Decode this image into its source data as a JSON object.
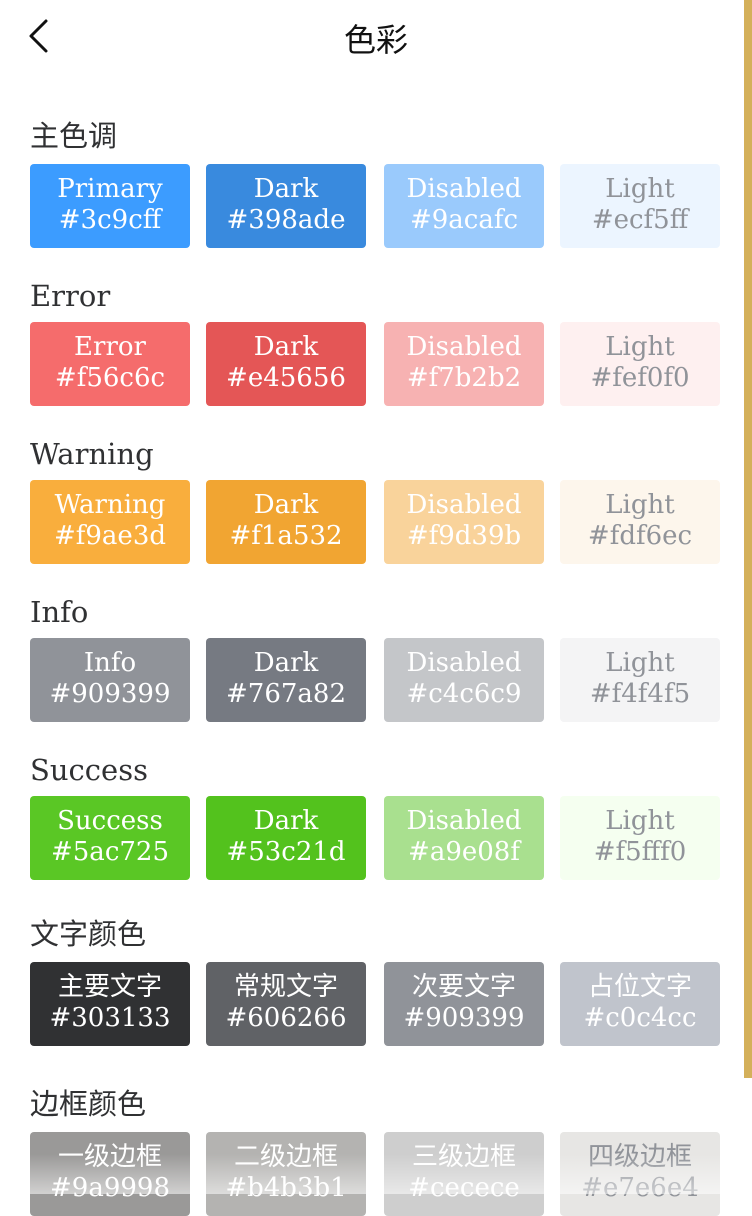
{
  "header": {
    "title": "色彩",
    "back_icon": "chevron-left-icon"
  },
  "accent_edge_color": "#d4b05a",
  "sections": [
    {
      "title": "主色调",
      "swatches": [
        {
          "label": "Primary",
          "value": "#3c9cff",
          "bg": "#3c9cff",
          "fg": "#ffffff"
        },
        {
          "label": "Dark",
          "value": "#398ade",
          "bg": "#398ade",
          "fg": "#ffffff"
        },
        {
          "label": "Disabled",
          "value": "#9acafc",
          "bg": "#9acafc",
          "fg": "#ffffff"
        },
        {
          "label": "Light",
          "value": "#ecf5ff",
          "bg": "#ecf5ff",
          "fg": "#909399"
        }
      ]
    },
    {
      "title": "Error",
      "swatches": [
        {
          "label": "Error",
          "value": "#f56c6c",
          "bg": "#f56c6c",
          "fg": "#ffffff"
        },
        {
          "label": "Dark",
          "value": "#e45656",
          "bg": "#e45656",
          "fg": "#ffffff"
        },
        {
          "label": "Disabled",
          "value": "#f7b2b2",
          "bg": "#f7b2b2",
          "fg": "#ffffff"
        },
        {
          "label": "Light",
          "value": "#fef0f0",
          "bg": "#fef0f0",
          "fg": "#909399"
        }
      ]
    },
    {
      "title": "Warning",
      "swatches": [
        {
          "label": "Warning",
          "value": "#f9ae3d",
          "bg": "#f9ae3d",
          "fg": "#ffffff"
        },
        {
          "label": "Dark",
          "value": "#f1a532",
          "bg": "#f1a532",
          "fg": "#ffffff"
        },
        {
          "label": "Disabled",
          "value": "#f9d39b",
          "bg": "#f9d39b",
          "fg": "#ffffff"
        },
        {
          "label": "Light",
          "value": "#fdf6ec",
          "bg": "#fdf6ec",
          "fg": "#909399"
        }
      ]
    },
    {
      "title": "Info",
      "swatches": [
        {
          "label": "Info",
          "value": "#909399",
          "bg": "#909399",
          "fg": "#ffffff"
        },
        {
          "label": "Dark",
          "value": "#767a82",
          "bg": "#767a82",
          "fg": "#ffffff"
        },
        {
          "label": "Disabled",
          "value": "#c4c6c9",
          "bg": "#c4c6c9",
          "fg": "#ffffff"
        },
        {
          "label": "Light",
          "value": "#f4f4f5",
          "bg": "#f4f4f5",
          "fg": "#909399"
        }
      ]
    },
    {
      "title": "Success",
      "swatches": [
        {
          "label": "Success",
          "value": "#5ac725",
          "bg": "#5ac725",
          "fg": "#ffffff"
        },
        {
          "label": "Dark",
          "value": "#53c21d",
          "bg": "#53c21d",
          "fg": "#ffffff"
        },
        {
          "label": "Disabled",
          "value": "#a9e08f",
          "bg": "#a9e08f",
          "fg": "#ffffff"
        },
        {
          "label": "Light",
          "value": "#f5fff0",
          "bg": "#f5fff0",
          "fg": "#909399"
        }
      ]
    },
    {
      "title": "文字颜色",
      "swatches": [
        {
          "label": "主要文字",
          "value": "#303133",
          "bg": "#303133",
          "fg": "#ffffff"
        },
        {
          "label": "常规文字",
          "value": "#606266",
          "bg": "#606266",
          "fg": "#ffffff"
        },
        {
          "label": "次要文字",
          "value": "#909399",
          "bg": "#909399",
          "fg": "#ffffff"
        },
        {
          "label": "占位文字",
          "value": "#c0c4cc",
          "bg": "#c0c4cc",
          "fg": "#ffffff"
        }
      ]
    },
    {
      "title": "边框颜色",
      "swatches": [
        {
          "label": "一级边框",
          "value": "#9a9998",
          "bg": "#9a9998",
          "fg": "#ffffff"
        },
        {
          "label": "二级边框",
          "value": "#b4b3b1",
          "bg": "#b4b3b1",
          "fg": "#ffffff"
        },
        {
          "label": "三级边框",
          "value": "#cecece",
          "bg": "#cecece",
          "fg": "#ffffff"
        },
        {
          "label": "四级边框",
          "value": "#e7e6e4",
          "bg": "#e7e6e4",
          "fg": "#909399"
        }
      ]
    }
  ]
}
